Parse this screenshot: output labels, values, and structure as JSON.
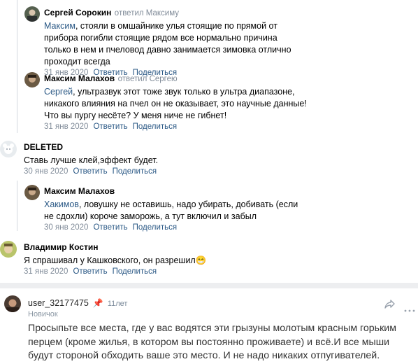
{
  "comments": [
    {
      "author": "Сергей Сорокин",
      "replied": "ответил Максиму",
      "mention": "Максим",
      "text": ", стояли в омшайнике улья стоящие по прямой от прибора погибли стоящие рядом все нормально причина только в нем и пчеловод давно занимается зимовка отлично проходит всегда",
      "date": "31 янв 2020",
      "reply": "Ответить",
      "share": "Поделиться"
    },
    {
      "author": "Максим Малахов",
      "replied": "ответил Сергею",
      "mention": "Сергей",
      "text": ", ультразвук этот тоже звук только в ультра диапазоне, никакого влияния на пчел он не оказывает, это научные данные! Что вы пургу несёте? У меня ниче не гибнет!",
      "date": "31 янв 2020",
      "reply": "Ответить",
      "share": "Поделиться"
    },
    {
      "author": "DELETED",
      "replied": "",
      "mention": "",
      "text": "Ставь лучше клей,эффект будет.",
      "date": "30 янв 2020",
      "reply": "Ответить",
      "share": "Поделиться"
    },
    {
      "author": "Максим Малахов",
      "replied": "",
      "mention": "Хакимов",
      "text": ", ловушку не оставишь, надо убирать, добивать (если не сдохли) короче заморожь, а тут включил и забыл",
      "date": "30 янв 2020",
      "reply": "Ответить",
      "share": "Поделиться"
    },
    {
      "author": "Владимир Костин",
      "replied": "",
      "mention": "",
      "text": "Я спрашивал у Кашковского, он разрешил",
      "emoji": "😁",
      "date": "31 янв 2020",
      "reply": "Ответить",
      "share": "Поделиться"
    }
  ],
  "forum_post": {
    "username": "user_32177475",
    "years": "11лет",
    "rank": "Новичок",
    "text": "Просыпьте все места, где у вас водятся эти грызуны молотым красным горьким перцем (кроме жилья, в котором вы постоянно проживаете) и всё.И все мыши будут стороной обходить ваше это место. И не надо никаких отпугивателей."
  },
  "colors": {
    "link": "#2a5885",
    "meta": "#818c99",
    "separator": "#edeef0"
  }
}
